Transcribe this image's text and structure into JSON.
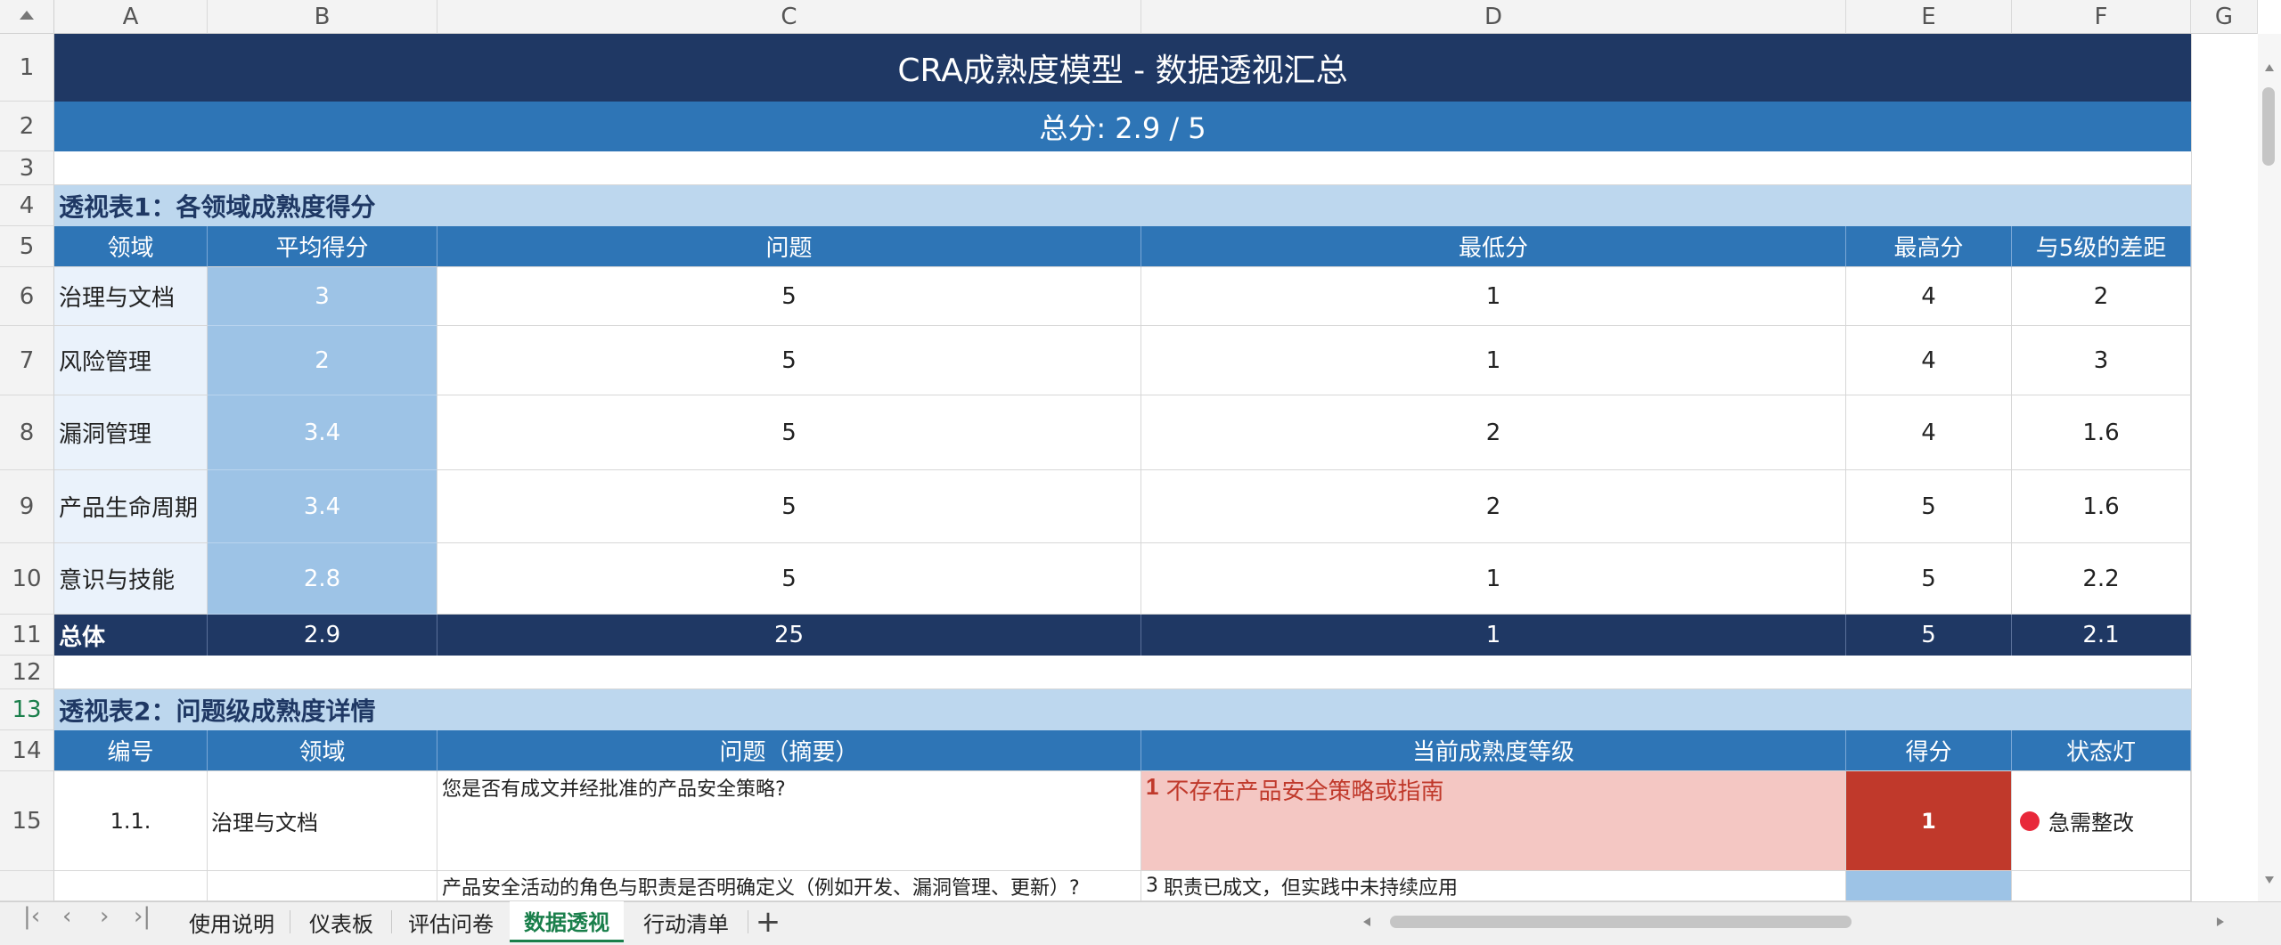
{
  "columns": [
    "A",
    "B",
    "C",
    "D",
    "E",
    "F",
    "G"
  ],
  "rows": [
    "1",
    "2",
    "3",
    "4",
    "5",
    "6",
    "7",
    "8",
    "9",
    "10",
    "11",
    "12",
    "13",
    "14",
    "15"
  ],
  "title": "CRA成熟度模型 - 数据透视汇总",
  "total_score": "总分: 2.9 / 5",
  "pivot1": {
    "title": "透视表1：各领域成熟度得分",
    "headers": [
      "领域",
      "平均得分",
      "问题",
      "最低分",
      "最高分",
      "与5级的差距"
    ],
    "rows": [
      {
        "domain": "治理与文档",
        "avg": "3",
        "count": "5",
        "min": "1",
        "max": "4",
        "gap": "2"
      },
      {
        "domain": "风险管理",
        "avg": "2",
        "count": "5",
        "min": "1",
        "max": "4",
        "gap": "3"
      },
      {
        "domain": "漏洞管理",
        "avg": "3.4",
        "count": "5",
        "min": "2",
        "max": "4",
        "gap": "1.6"
      },
      {
        "domain": "产品生命周期",
        "avg": "3.4",
        "count": "5",
        "min": "2",
        "max": "5",
        "gap": "1.6"
      },
      {
        "domain": "意识与技能",
        "avg": "2.8",
        "count": "5",
        "min": "1",
        "max": "5",
        "gap": "2.2"
      }
    ],
    "total": {
      "label": "总体",
      "avg": "2.9",
      "count": "25",
      "min": "1",
      "max": "5",
      "gap": "2.1"
    }
  },
  "pivot2": {
    "title": "透视表2：问题级成熟度详情",
    "headers": [
      "编号",
      "领域",
      "问题（摘要）",
      "当前成熟度等级",
      "得分",
      "状态灯"
    ],
    "rows": [
      {
        "id": "1.1.",
        "domain": "治理与文档",
        "question": "您是否有成文并经批准的产品安全策略?",
        "level_num": "1",
        "level_text": "不存在产品安全策略或指南",
        "score": "1",
        "status": "急需整改"
      },
      {
        "id": "",
        "domain": "",
        "question": "产品安全活动的角色与职责是否明确定义（例如开发、漏洞管理、更新）?",
        "level_num": "3",
        "level_text": "职责已成文，但实践中未持续应用",
        "score": "",
        "status": ""
      }
    ]
  },
  "sheet_tabs": [
    "使用说明",
    "仪表板",
    "评估问卷",
    "数据透视",
    "行动清单"
  ],
  "active_tab": "数据透视",
  "colors": {
    "title_bg": "#1f3864",
    "header_bg": "#2e75b6",
    "section_bg": "#bdd7ee",
    "avg_bg": "#9dc3e6",
    "alert_bg": "#c0392b",
    "level_bg": "#f4c7c3",
    "active_tab": "#1a7f4b"
  }
}
